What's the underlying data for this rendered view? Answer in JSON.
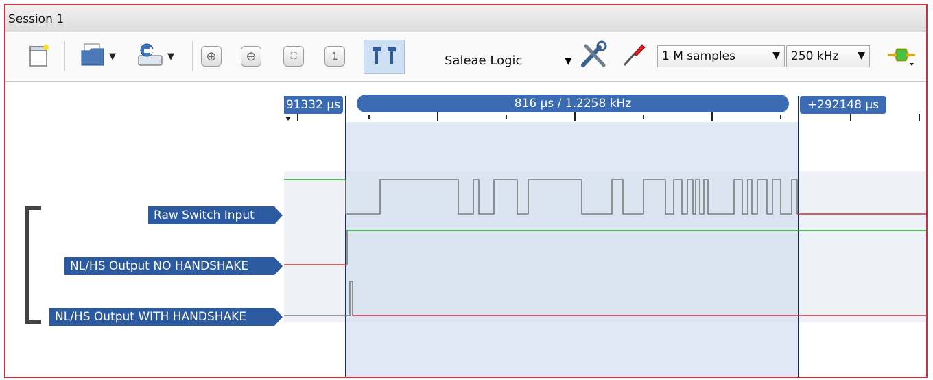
{
  "tab": {
    "label": "Session 1"
  },
  "toolbar": {
    "device_name": "Saleae Logic",
    "samples": "1 M samples",
    "rate": "250 kHz"
  },
  "timeline": {
    "left_marker": "91332 µs",
    "measure": "816 µs / 1.2258 kHz",
    "right_marker": "+292148 µs"
  },
  "channels": [
    {
      "name": "Raw Switch Input"
    },
    {
      "name": "NL/HS Output NO HANDSHAKE"
    },
    {
      "name": "NL/HS Output WITH HANDSHAKE"
    }
  ],
  "colors": {
    "high": "#22a82a",
    "low": "#c8323c",
    "label_bg": "#2c5aa0",
    "selection": "#d4e0f0"
  },
  "icons": [
    "new-session-icon",
    "open-folder-icon",
    "save-icon",
    "zoom-in-icon",
    "zoom-out-icon",
    "fit-icon",
    "zoom-one-icon",
    "cursor-markers-icon",
    "tools-icon",
    "probe-icon",
    "channel-icon"
  ]
}
